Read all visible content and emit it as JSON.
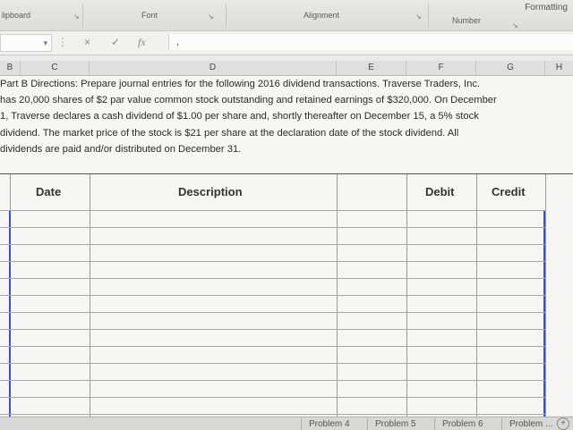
{
  "ribbon": {
    "groups": [
      "lipboard",
      "Font",
      "Alignment",
      "Number"
    ],
    "formatting": "Formatting"
  },
  "formula_bar": {
    "name_box_arrow": "▾",
    "cancel_icon": "×",
    "enter_icon": "✓",
    "fx_label": "fx",
    "value": ","
  },
  "columns": [
    "B",
    "C",
    "D",
    "E",
    "F",
    "G",
    "H"
  ],
  "directions": [
    "Part B Directions:  Prepare journal entries for the following 2016 dividend transactions.  Traverse Traders, Inc.",
    "has 20,000 shares of $2 par value common stock outstanding and retained earnings of $320,000. On December",
    "1, Traverse declares a cash dividend of $1.00 per share and, shortly thereafter on December 15, a 5% stock",
    "dividend. The market price of the stock is $21 per share at the declaration date of the stock dividend.  All",
    "dividends are paid and/or distributed on December 31."
  ],
  "table": {
    "headers": {
      "date": "Date",
      "description": "Description",
      "debit": "Debit",
      "credit": "Credit"
    },
    "row_count": 12
  },
  "sheet_tabs": [
    "Problem 4",
    "Problem 5",
    "Problem 6",
    "Problem ..."
  ],
  "colors": {
    "accent_border": "#3a4fd6"
  }
}
